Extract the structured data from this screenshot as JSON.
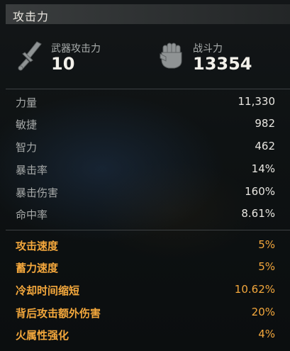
{
  "title": "攻击力",
  "header": {
    "weapon": {
      "label": "武器攻击力",
      "value": "10",
      "icon": "sword-icon"
    },
    "combat": {
      "label": "战斗力",
      "value": "13354",
      "icon": "fist-icon"
    }
  },
  "base_stats": [
    {
      "name": "力量",
      "value": "11,330"
    },
    {
      "name": "敏捷",
      "value": "982"
    },
    {
      "name": "智力",
      "value": "462"
    },
    {
      "name": "暴击率",
      "value": "14%"
    },
    {
      "name": "暴击伤害",
      "value": "160%"
    },
    {
      "name": "命中率",
      "value": "8.61%"
    }
  ],
  "bonus_stats": [
    {
      "name": "攻击速度",
      "value": "5%"
    },
    {
      "name": "蓄力速度",
      "value": "5%"
    },
    {
      "name": "冷却时间缩短",
      "value": "10.62%"
    },
    {
      "name": "背后攻击额外伤害",
      "value": "20%"
    },
    {
      "name": "火属性强化",
      "value": "4%"
    }
  ],
  "colors": {
    "bonus": "#f3a73c",
    "base_label": "#a7aaa9",
    "base_value": "#e8e6e1"
  }
}
